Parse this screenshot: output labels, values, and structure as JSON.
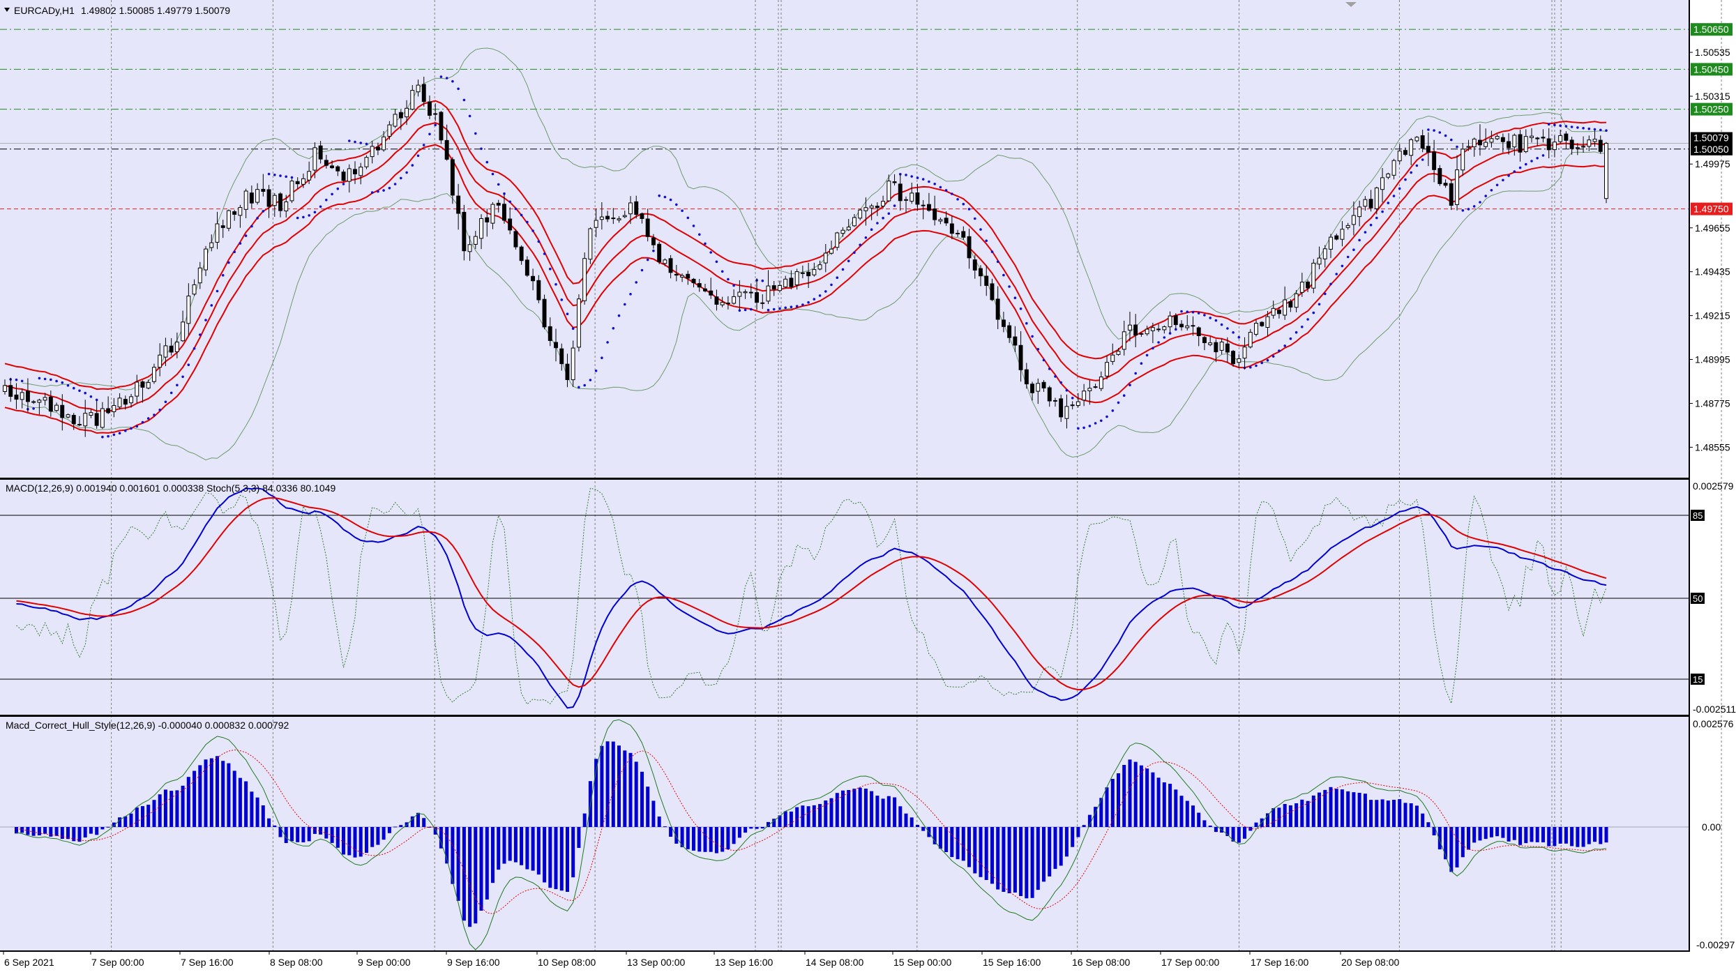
{
  "window": {
    "symbol_line": "EURCADy,H1",
    "ohlc_text": "1.49802 1.50085 1.49779 1.50079"
  },
  "panes": {
    "price": {
      "ylim": [
        1.4842,
        1.5078
      ],
      "scale_labels": [
        "1.50535",
        "1.50315",
        "1.49975",
        "1.49655",
        "1.49435",
        "1.49215",
        "1.48995",
        "1.48775",
        "1.48555"
      ],
      "scale_values": [
        1.50535,
        1.50315,
        1.49975,
        1.49655,
        1.49435,
        1.49215,
        1.48995,
        1.48775,
        1.48555
      ],
      "levels": [
        {
          "label": "1.50650",
          "value": 1.5065,
          "color": "#1f8b1f",
          "style": "dashdot"
        },
        {
          "label": "1.50450",
          "value": 1.5045,
          "color": "#1f8b1f",
          "style": "dashdot"
        },
        {
          "label": "1.50250",
          "value": 1.5025,
          "color": "#1f8b1f",
          "style": "dashdot"
        },
        {
          "label": "1.50050",
          "value": 1.5005,
          "color": "#000000",
          "style": "dashdot"
        },
        {
          "label": "1.49750",
          "value": 1.4975,
          "color": "#e81e1e",
          "style": "dash"
        }
      ],
      "current_price": {
        "label": "1.50079",
        "value": 1.50079
      }
    },
    "macd_stoch": {
      "title": "MACD(12,26,9) 0.001940 0.001601 0.000338  Stoch(5,3,3) 84.0336 80.1049",
      "scale_top": "0.002579",
      "scale_bottom": "-0.002511",
      "levels": [
        {
          "label": "85",
          "value": 85
        },
        {
          "label": "50",
          "value": 50
        },
        {
          "label": "15",
          "value": 15
        }
      ]
    },
    "hull": {
      "title": "Macd_Correct_Hull_Style(12,26,9) -0.000040 0.000832 0.000792",
      "scale_top": "0.002576",
      "scale_zero": "0.00",
      "scale_bottom": "-0.00297"
    }
  },
  "time_axis": {
    "labels": [
      "6 Sep 2021",
      "7 Sep 00:00",
      "7 Sep 16:00",
      "8 Sep 08:00",
      "9 Sep 00:00",
      "9 Sep 16:00",
      "10 Sep 08:00",
      "13 Sep 00:00",
      "13 Sep 16:00",
      "14 Sep 08:00",
      "15 Sep 00:00",
      "15 Sep 16:00",
      "16 Sep 08:00",
      "17 Sep 00:00",
      "17 Sep 16:00",
      "20 Sep 08:00"
    ]
  },
  "colors": {
    "background": "#e6e6fa",
    "grid": "#808080",
    "bull_candle": "#ffffff",
    "bear_candle": "#000000",
    "envelope": "#e00000",
    "bollinger": "#6b9b6b",
    "psar": "#1010d0",
    "macd_main": "#0000d0",
    "macd_signal": "#e00000",
    "stoch": "#2e7d2e",
    "hull_hist": "#0000d0",
    "hull_line": "#1e7a1e",
    "hull_signal": "#e00000"
  },
  "chart_data": {
    "type": "candlestick",
    "symbol": "EURCADy",
    "timeframe": "H1",
    "bars": 280,
    "close_anchors": [
      [
        0,
        1.4885
      ],
      [
        6,
        1.4878
      ],
      [
        12,
        1.4868
      ],
      [
        18,
        1.4872
      ],
      [
        24,
        1.4886
      ],
      [
        30,
        1.491
      ],
      [
        36,
        1.4962
      ],
      [
        42,
        1.4982
      ],
      [
        48,
        1.4978
      ],
      [
        54,
        1.5002
      ],
      [
        60,
        1.4992
      ],
      [
        66,
        1.5012
      ],
      [
        72,
        1.5038
      ],
      [
        76,
        1.5012
      ],
      [
        80,
        1.4958
      ],
      [
        86,
        1.4978
      ],
      [
        92,
        1.4935
      ],
      [
        98,
        1.489
      ],
      [
        102,
        1.4965
      ],
      [
        110,
        1.4975
      ],
      [
        116,
        1.494
      ],
      [
        124,
        1.493
      ],
      [
        132,
        1.4932
      ],
      [
        140,
        1.4945
      ],
      [
        148,
        1.4968
      ],
      [
        154,
        1.4985
      ],
      [
        160,
        1.498
      ],
      [
        166,
        1.4962
      ],
      [
        172,
        1.493
      ],
      [
        178,
        1.489
      ],
      [
        184,
        1.4872
      ],
      [
        190,
        1.489
      ],
      [
        196,
        1.4915
      ],
      [
        204,
        1.4918
      ],
      [
        210,
        1.4908
      ],
      [
        214,
        1.49
      ],
      [
        220,
        1.492
      ],
      [
        226,
        1.4935
      ],
      [
        232,
        1.4962
      ],
      [
        238,
        1.4978
      ],
      [
        243,
        1.5002
      ],
      [
        246,
        1.5008
      ],
      [
        248,
        1.5001
      ],
      [
        252,
        1.49802
      ],
      [
        254,
        1.50079
      ]
    ]
  }
}
